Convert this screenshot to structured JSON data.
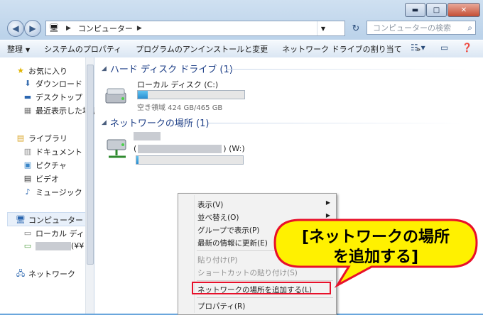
{
  "window": {
    "caption": {
      "minimize": "▬",
      "maximize": "□",
      "close": "✕"
    }
  },
  "address": {
    "crumb": "コンピューター",
    "search_placeholder": "コンピューターの検索"
  },
  "toolbar": {
    "organize": "整理",
    "system_properties": "システムのプロパティ",
    "uninstall": "プログラムのアンインストールと変更",
    "map_drive": "ネットワーク ドライブの割り当て",
    "more": "»"
  },
  "nav": {
    "favorites": "お気に入り",
    "downloads": "ダウンロード",
    "desktop": "デスクトップ",
    "recent": "最近表示した場所",
    "libraries": "ライブラリ",
    "documents": "ドキュメント",
    "pictures": "ピクチャ",
    "videos": "ビデオ",
    "music": "ミュージック",
    "computer": "コンピューター",
    "local_disk": "ローカル ディス",
    "net_drive_suffix": "(¥¥",
    "network": "ネットワーク"
  },
  "content": {
    "hdd_group": "ハード ディスク ドライブ (1)",
    "local_disk_name": "ローカル ディスク (C:)",
    "local_disk_free": "空き領域 424 GB/465 GB",
    "local_disk_used_fraction": 0.09,
    "net_group": "ネットワークの場所 (1)",
    "net_drive_prefix": "(",
    "net_drive_suffix": ") (W:)",
    "net_drive_used_fraction": 0.02
  },
  "context_menu": {
    "view": "表示(V)",
    "sort": "並べ替え(O)",
    "group": "グループで表示(P)",
    "refresh": "最新の情報に更新(E)",
    "paste": "貼り付け(P)",
    "paste_shortcut": "ショートカットの貼り付け(S)",
    "add_network_location": "ネットワークの場所を追加する(L)",
    "properties": "プロパティ(R)"
  },
  "callout": {
    "line1": "[ネットワークの場所",
    "line2": "を追加する]"
  },
  "colors": {
    "accent_group": "#1e3f87",
    "highlight_box": "#e8102a",
    "callout_fill": "#fff100",
    "callout_border": "#e8102a"
  }
}
